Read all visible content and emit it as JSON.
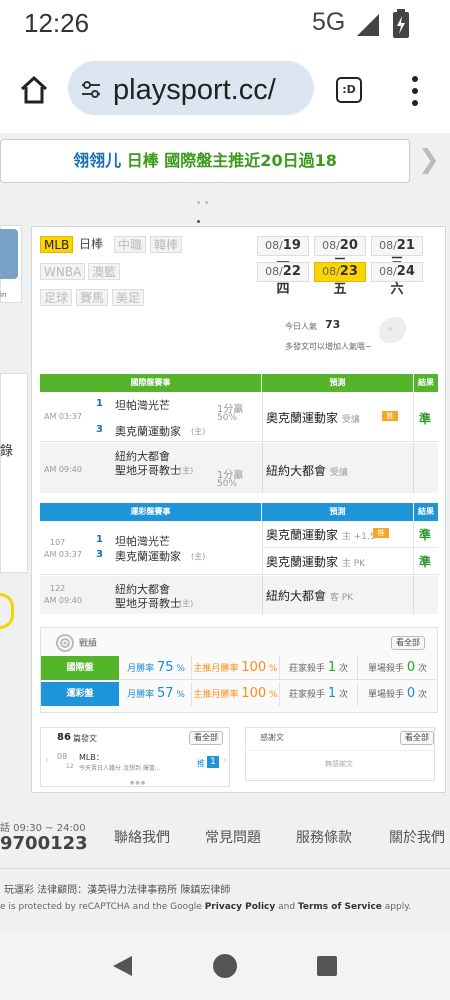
{
  "status": {
    "time": "12:26",
    "network": "5G"
  },
  "browser": {
    "url": "playsport.cc/",
    "tab_icon": ":D"
  },
  "marquee": {
    "name": "翎翎儿",
    "text": "日棒 國際盤主推近20日過18"
  },
  "left_panel": {
    "label_fragment": "錄",
    "small_text": "in"
  },
  "sports": {
    "active": "MLB",
    "row1": [
      "日棒",
      "中職",
      "韓棒"
    ],
    "row2": [
      "WNBA",
      "澳籃"
    ],
    "row3": [
      "足球",
      "賽馬",
      "美足"
    ]
  },
  "dates": [
    {
      "md": "08/",
      "d": "19",
      "w": "一"
    },
    {
      "md": "08/",
      "d": "20",
      "w": "二"
    },
    {
      "md": "08/",
      "d": "21",
      "w": "三"
    },
    {
      "md": "08/",
      "d": "22",
      "w": "四"
    },
    {
      "md": "08/",
      "d": "23",
      "w": "五"
    },
    {
      "md": "08/",
      "d": "24",
      "w": "六"
    }
  ],
  "popularity": {
    "label": "今日人氣",
    "value": "73",
    "hint": "多發文可以增加人氣哦~"
  },
  "intl": {
    "header": "國際盤賽事",
    "pred_header": "預測",
    "result_header": "結果",
    "rows": [
      {
        "time": "AM 03:37",
        "n1": "1",
        "team1": "坦帕灣光芒",
        "n2": "3",
        "team2": "奧克蘭運動家",
        "team2_tag": "(主)",
        "line": "1分贏",
        "pct": "50%",
        "pick": "奧克蘭運動家",
        "pick_type": "受讓",
        "badge": "推",
        "result": "準"
      },
      {
        "time": "AM 09:40",
        "n1": "",
        "team1": "紐約大都會",
        "n2": "",
        "team2": "聖地牙哥教士",
        "team2_tag": "(主)",
        "line": "1分贏",
        "pct": "50%",
        "pick": "紐約大都會",
        "pick_type": "受讓",
        "badge": "",
        "result": ""
      }
    ]
  },
  "lottery": {
    "header": "運彩盤賽事",
    "pred_header": "預測",
    "result_header": "結果",
    "rows": [
      {
        "num": "107",
        "time": "AM 03:37",
        "n1": "1",
        "team1": "坦帕灣光芒",
        "n2": "3",
        "team2": "奧克蘭運動家",
        "team2_tag": "(主)",
        "picks": [
          {
            "team": "奧克蘭運動家",
            "type": "主 +1.5",
            "badge": "推",
            "result": "準"
          },
          {
            "team": "奧克蘭運動家",
            "type": "主 PK",
            "badge": "",
            "result": "準"
          }
        ]
      },
      {
        "num": "122",
        "time": "AM 09:40",
        "n1": "",
        "team1": "紐約大都會",
        "n2": "",
        "team2": "聖地牙哥教士",
        "team2_tag": "(主)",
        "picks": [
          {
            "team": "紐約大都會",
            "type": "客 PK",
            "badge": "",
            "result": ""
          }
        ]
      }
    ]
  },
  "record": {
    "title": "戰績",
    "view_all": "看全部",
    "rows": [
      {
        "label": "國際盤",
        "month_label": "月勝率",
        "month": "75",
        "main_label": "主推月勝率",
        "main": "100",
        "banker_label": "莊家殺手",
        "banker": "1",
        "single_label": "單場殺手",
        "single": "0",
        "unit": "次"
      },
      {
        "label": "運彩盤",
        "month_label": "月勝率",
        "month": "57",
        "main_label": "主推月勝率",
        "main": "100",
        "banker_label": "莊家殺手",
        "banker": "1",
        "single_label": "單場殺手",
        "single": "0",
        "unit": "次"
      }
    ]
  },
  "posts": {
    "count": "86",
    "label": "篇發文",
    "view_all": "看全部",
    "date_top": "08",
    "date_bottom": "12",
    "title": "MLB：",
    "snippet": "今天賣日人鐵分 沒想到 爆冒...",
    "push_label": "推",
    "push_count": "1"
  },
  "thanks": {
    "title": "感謝文",
    "view_all": "看全部",
    "empty": "無感謝文"
  },
  "contact": {
    "hours": "話 09:30 ~ 24:00",
    "phone": "9700123"
  },
  "footer_links": [
    "聯絡我們",
    "常見問題",
    "服務條款",
    "關於我們"
  ],
  "legal": {
    "line1": "玩運彩 法律顧問：漢英得力法律事務所 陳鎮宏律師",
    "line2_a": "e is protected by reCAPTCHA and the Google ",
    "privacy": "Privacy Policy",
    "and": " and ",
    "terms": "Terms of Service",
    "apply": " apply."
  }
}
